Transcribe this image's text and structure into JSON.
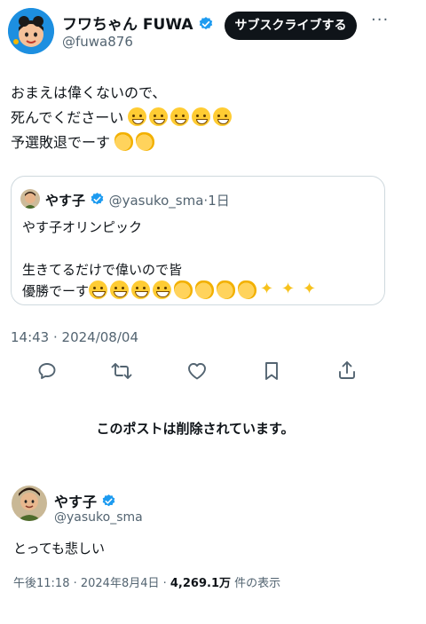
{
  "main_post": {
    "display_name": "フワちゃん FUWA",
    "handle": "@fuwa876",
    "subscribe_label": "サブスクライブする",
    "more_label": "···",
    "lines": [
      "おまえは偉くないので、",
      "死んでくださーい",
      "予選敗退でーす"
    ],
    "line2_emoji": [
      "sweat-smile-emoji",
      "sweat-smile-emoji",
      "sweat-smile-emoji",
      "sweat-smile-emoji",
      "sweat-smile-emoji"
    ],
    "line3_emoji": [
      "clapping-hands-emoji",
      "clapping-hands-emoji"
    ],
    "timestamp": "14:43 · 2024/08/04"
  },
  "quoted_post": {
    "display_name": "やす子",
    "handle": "@yasuko_sma",
    "time_sep": "·",
    "time": "1日",
    "line1": "やす子オリンピック",
    "line2": "生きてるだけで偉いので皆",
    "line3": "優勝でーす"
  },
  "deleted_notice": "このポストは削除されています。",
  "reply_post": {
    "display_name": "やす子",
    "handle": "@yasuko_sma",
    "text": "とっても悲しい",
    "timestamp": "午後11:18 · 2024年8月4日 · ",
    "views_count": "4,269.1万",
    "views_label": " 件の表示"
  },
  "colors": {
    "verified": "#1d9bf0",
    "text": "#0f1419",
    "muted": "#536471",
    "border": "#cfd9de"
  }
}
